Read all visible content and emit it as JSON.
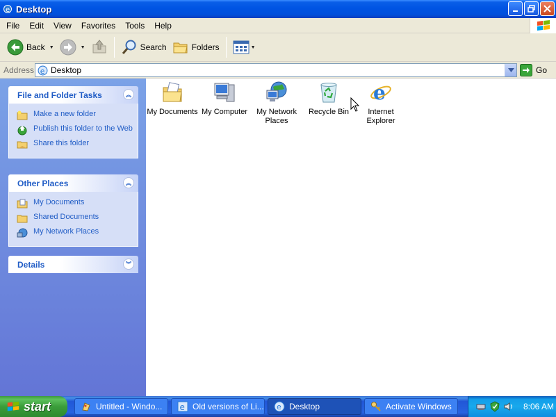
{
  "window": {
    "title": "Desktop",
    "controls": [
      "minimize-icon",
      "restore-icon",
      "close-icon"
    ]
  },
  "menubar": {
    "items": [
      "File",
      "Edit",
      "View",
      "Favorites",
      "Tools",
      "Help"
    ]
  },
  "toolbar": {
    "back_label": "Back",
    "search_label": "Search",
    "folders_label": "Folders"
  },
  "addressbar": {
    "label": "Address",
    "value": "Desktop",
    "go_label": "Go"
  },
  "sidebar": {
    "file_tasks": {
      "title": "File and Folder Tasks",
      "items": [
        "Make a new folder",
        "Publish this folder to the Web",
        "Share this folder"
      ]
    },
    "other_places": {
      "title": "Other Places",
      "items": [
        "My Documents",
        "Shared Documents",
        "My Network Places"
      ]
    },
    "details": {
      "title": "Details"
    }
  },
  "desktop": {
    "items": [
      {
        "label": "My Documents",
        "icon": "my-documents-icon"
      },
      {
        "label": "My Computer",
        "icon": "my-computer-icon"
      },
      {
        "label": "My Network Places",
        "icon": "network-places-icon"
      },
      {
        "label": "Recycle Bin",
        "icon": "recycle-bin-icon"
      },
      {
        "label": "Internet Explorer",
        "icon": "internet-explorer-icon"
      }
    ]
  },
  "taskbar": {
    "start_label": "start",
    "buttons": [
      "Untitled - Windo...",
      "Old versions of Li...",
      "Desktop",
      "Activate Windows"
    ],
    "active_button": "Desktop",
    "clock": "8:06 AM"
  }
}
